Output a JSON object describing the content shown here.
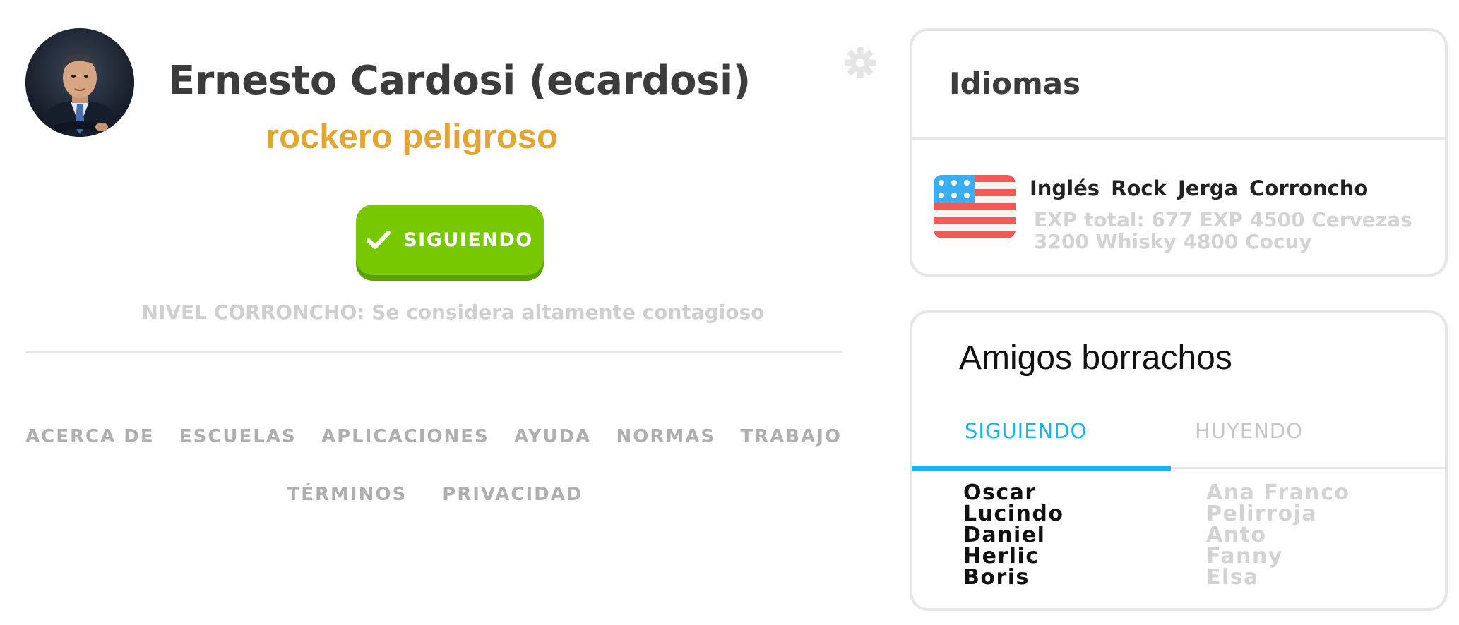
{
  "profile": {
    "name": "Ernesto Cardosi (ecardosi)",
    "subtitle": "rockero peligroso",
    "follow_button_label": "SIGUIENDO",
    "level_text": "NIVEL CORRONCHO: Se considera altamente contagioso"
  },
  "footer": {
    "links_row1": [
      "ACERCA DE",
      "ESCUELAS",
      "APLICACIONES",
      "AYUDA",
      "NORMAS",
      "TRABAJO"
    ],
    "links_row2": [
      "TÉRMINOS",
      "PRIVACIDAD"
    ]
  },
  "languages": {
    "title": "Idiomas",
    "items": [
      {
        "name": "Inglés  Rock  Jerga Corroncho",
        "exp": "EXP total: 677 EXP 4500 Cervezas 3200 Whisky 4800 Cocuy",
        "icon": "us-flag-icon"
      }
    ]
  },
  "friends": {
    "title": "Amigos borrachos",
    "tabs": [
      "SIGUIENDO",
      "HUYENDO"
    ],
    "active_tab": "SIGUIENDO",
    "following": [
      "Oscar",
      "Lucindo",
      "Daniel",
      "Herlic",
      "Boris"
    ],
    "fleeing": [
      "Ana Franco",
      "Pelirroja",
      "Anto",
      "Fanny",
      "Elsa"
    ]
  },
  "colors": {
    "accent_green": "#78c800",
    "subtitle_orange": "#e2a531",
    "tab_blue": "#1cb0f6",
    "muted_gray": "#afafaf"
  }
}
